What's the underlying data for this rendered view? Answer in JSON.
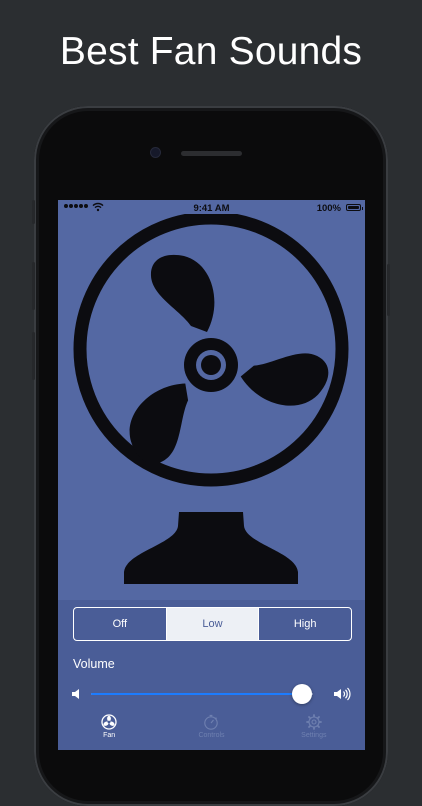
{
  "headline": "Best Fan Sounds",
  "status_bar": {
    "time": "9:41 AM",
    "battery": "100%",
    "icons": [
      "signal-dots",
      "wifi-icon",
      "battery-icon"
    ]
  },
  "fan_illustration": {
    "icon": "desk-fan-icon",
    "color": "#0c0c10"
  },
  "speed_control": {
    "options": [
      "Off",
      "Low",
      "High"
    ],
    "selected": "Low"
  },
  "volume": {
    "label": "Volume",
    "level": 0.95,
    "min_icon": "speaker-low-icon",
    "max_icon": "speaker-high-icon"
  },
  "tabs": [
    {
      "label": "Fan",
      "icon": "fan-icon",
      "active": true
    },
    {
      "label": "Controls",
      "icon": "stopwatch-icon",
      "active": false
    },
    {
      "label": "Settings",
      "icon": "gear-icon",
      "active": false
    }
  ],
  "colors": {
    "background": "#2b2e31",
    "screen": "#5468a3",
    "panel": "#4a5d97",
    "slider_fill": "#1c7cff",
    "tab_inactive": "#6f80b0"
  }
}
